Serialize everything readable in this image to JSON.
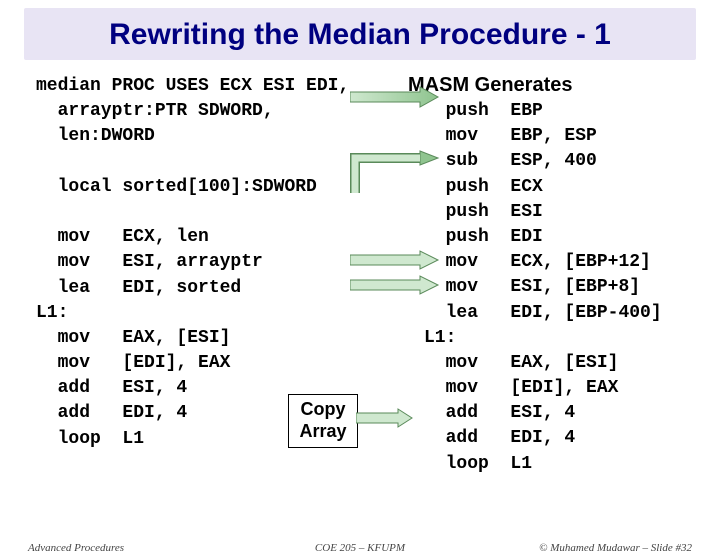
{
  "title": "Rewriting the Median Procedure - 1",
  "left": {
    "l1": "median PROC USES ECX ESI EDI,",
    "l2": "  arrayptr:PTR SDWORD,",
    "l3": "  len:DWORD",
    "l4": "",
    "l5": "  local sorted[100]:SDWORD",
    "l6": "",
    "l7": "  mov   ECX, len",
    "l8": "  mov   ESI, arrayptr",
    "l9": "  lea   EDI, sorted",
    "l10": "L1:",
    "l11": "  mov   EAX, [ESI]",
    "l12": "  mov   [EDI], EAX",
    "l13": "  add   ESI, 4",
    "l14": "  add   EDI, 4",
    "l15": "  loop  L1"
  },
  "masm_header": "MASM Generates",
  "right": {
    "r1": "push  EBP",
    "r2": "mov   EBP, ESP",
    "r3": "sub   ESP, 400",
    "r4": "push  ECX",
    "r5": "push  ESI",
    "r6": "push  EDI",
    "r7": "mov   ECX, [EBP+12]",
    "r8": "mov   ESI, [EBP+8]",
    "r9": "lea   EDI, [EBP-400]",
    "r10": "L1:",
    "r11": "  mov   EAX, [ESI]",
    "r12": "  mov   [EDI], EAX",
    "r13": "  add   ESI, 4",
    "r14": "  add   EDI, 4",
    "r15": "  loop  L1"
  },
  "copy": {
    "line1": "Copy",
    "line2": "Array"
  },
  "footer": {
    "left": "Advanced Procedures",
    "center": "COE 205 – KFUPM",
    "right": "© Muhamed Mudawar – Slide #32"
  }
}
